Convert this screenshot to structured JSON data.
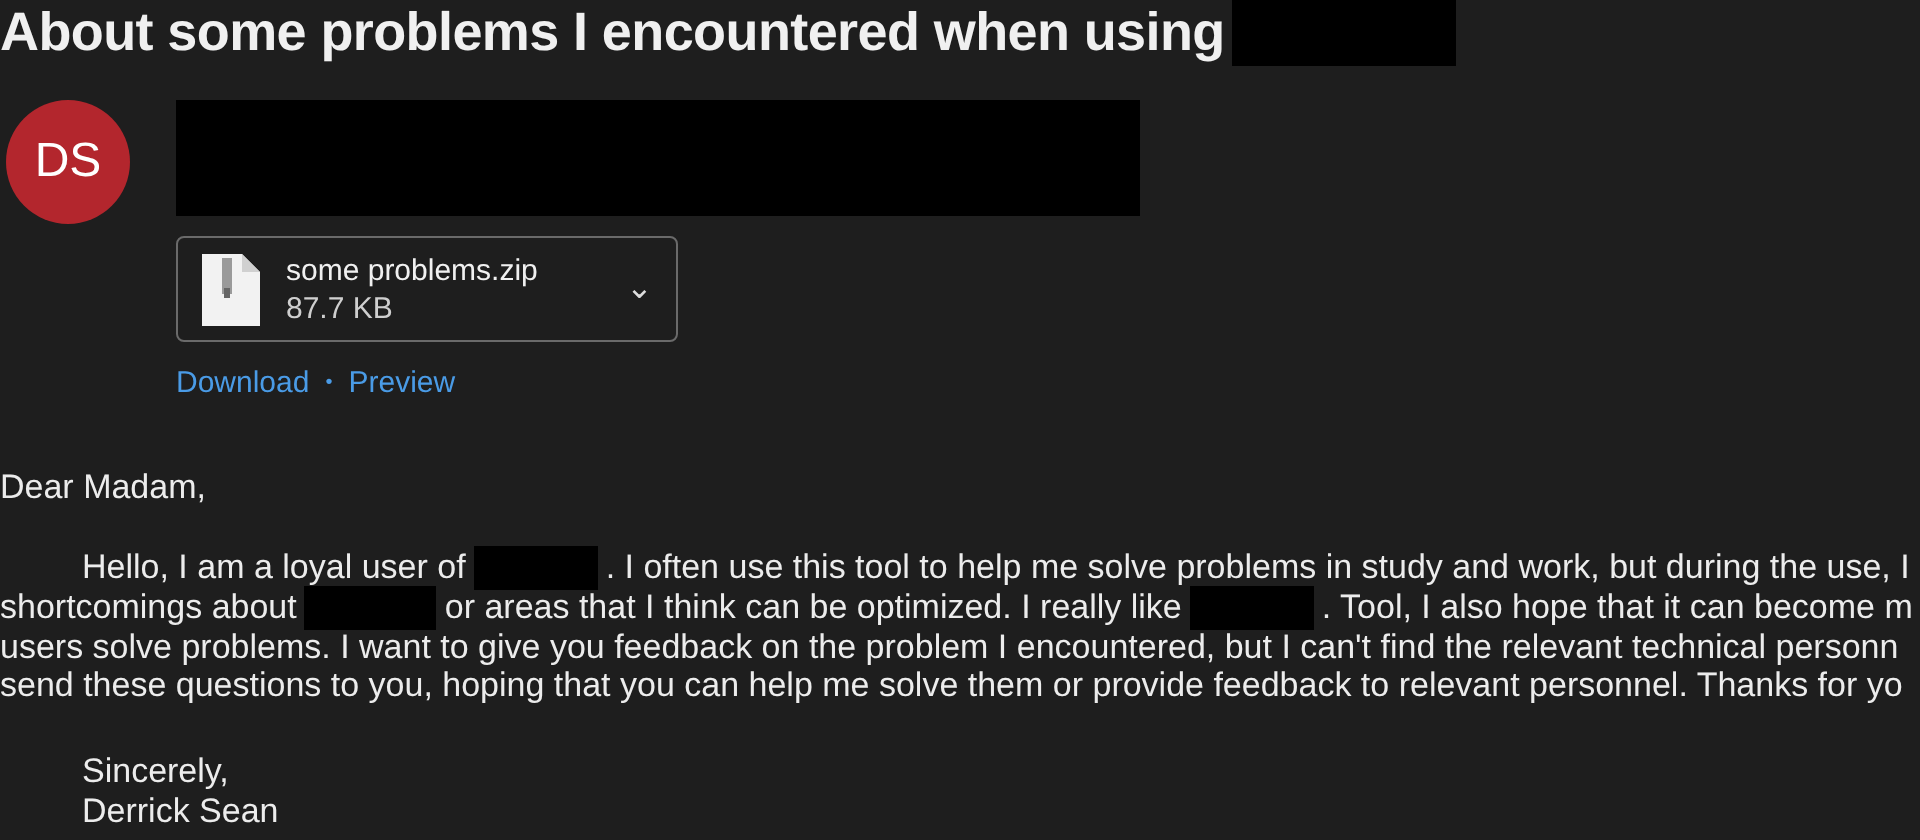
{
  "subject": [
    {
      "kind": "text",
      "text": "About some problems I encountered when using"
    },
    {
      "kind": "redacted"
    }
  ],
  "sender": {
    "initials": "DS",
    "redacted": true
  },
  "attachment": {
    "name": "some problems.zip",
    "size": "87.7 KB",
    "expand": "⌄"
  },
  "attachment_links": [
    {
      "label": "Download"
    },
    {
      "label": "Preview"
    }
  ],
  "link_separator": "•",
  "greeting": "Dear Madam,",
  "body_lines": [
    {
      "indent": true,
      "segments": [
        {
          "kind": "text",
          "text": "Hello, I am a loyal user of"
        },
        {
          "kind": "redacted"
        },
        {
          "kind": "text",
          "text": ". I often use this tool to help me solve problems in study and work, but during the use, I"
        }
      ]
    },
    {
      "indent": false,
      "segments": [
        {
          "kind": "text",
          "text": "shortcomings about"
        },
        {
          "kind": "redacted"
        },
        {
          "kind": "text",
          "text": "or areas that I think can be optimized. I really like"
        },
        {
          "kind": "redacted"
        },
        {
          "kind": "text",
          "text": ". Tool, I also hope that it can become m"
        }
      ]
    },
    {
      "indent": false,
      "segments": [
        {
          "kind": "text",
          "text": "users solve problems. I want to give you feedback on the problem I encountered, but I can't find the relevant technical personn"
        }
      ]
    },
    {
      "indent": false,
      "segments": [
        {
          "kind": "text",
          "text": "send these questions to you, hoping that you can help me solve them or provide feedback to relevant personnel. Thanks for yo"
        }
      ]
    }
  ],
  "closing": [
    "Sincerely,",
    "Derrick Sean"
  ]
}
